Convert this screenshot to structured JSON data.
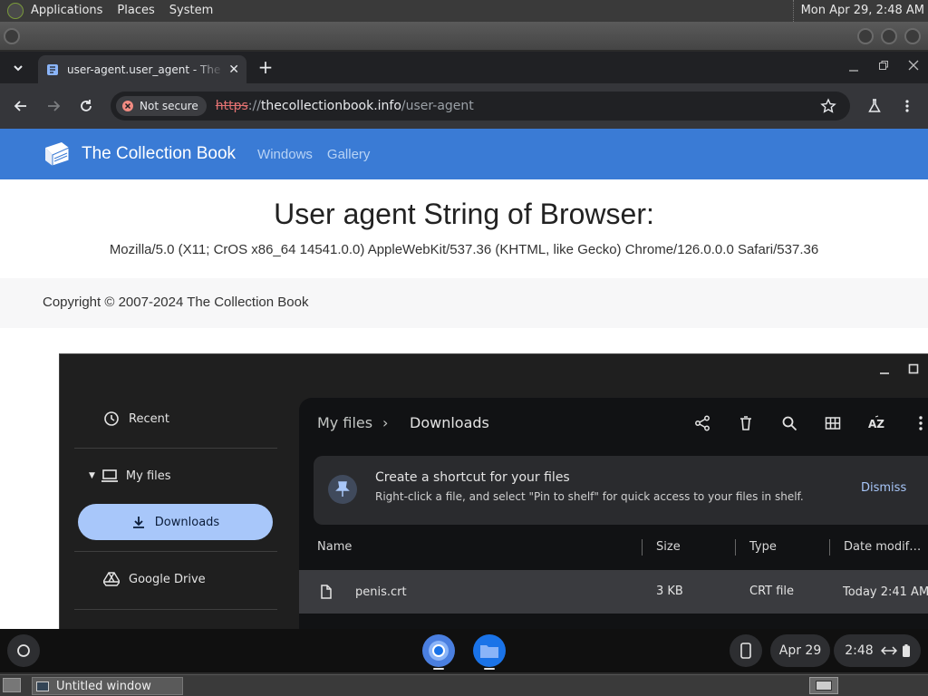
{
  "top_panel": {
    "menus": [
      "Applications",
      "Places",
      "System"
    ],
    "clock": "Mon Apr 29,  2:48 AM"
  },
  "browser": {
    "tab_title": "user-agent.user_agent - The Collection Book",
    "new_tab": "+",
    "security_chip": "Not secure",
    "url_scheme": "https",
    "url_sep": "://",
    "url_host": "thecollectionbook.info",
    "url_path": "/user-agent"
  },
  "site": {
    "brand": "The Collection Book",
    "nav": [
      "Windows",
      "Gallery"
    ],
    "heading": "User agent String of Browser:",
    "user_agent": "Mozilla/5.0 (X11; CrOS x86_64 14541.0.0) AppleWebKit/537.36 (KHTML, like Gecko) Chrome/126.0.0.0 Safari/537.36",
    "footer": "Copyright © 2007-2024 The Collection Book"
  },
  "files": {
    "sidebar": {
      "recent": "Recent",
      "my_files": "My files",
      "downloads": "Downloads",
      "google_drive": "Google Drive"
    },
    "breadcrumb": [
      "My files",
      "Downloads"
    ],
    "banner": {
      "title": "Create a shortcut for your files",
      "body": "Right-click a file, and select \"Pin to shelf\" for quick access to your files in shelf.",
      "dismiss": "Dismiss"
    },
    "columns": [
      "Name",
      "Size",
      "Type",
      "Date modif…"
    ],
    "rows": [
      {
        "name": "penis.crt",
        "size": "3 KB",
        "type": "CRT file",
        "date": "Today 2:41 AM"
      }
    ]
  },
  "shelf": {
    "date": "Apr 29",
    "time": "2:48"
  },
  "bottom_panel": {
    "task": "Untitled window"
  },
  "colors": {
    "site_nav": "#3a7bd5",
    "accent_pill": "#a8c7fa"
  }
}
